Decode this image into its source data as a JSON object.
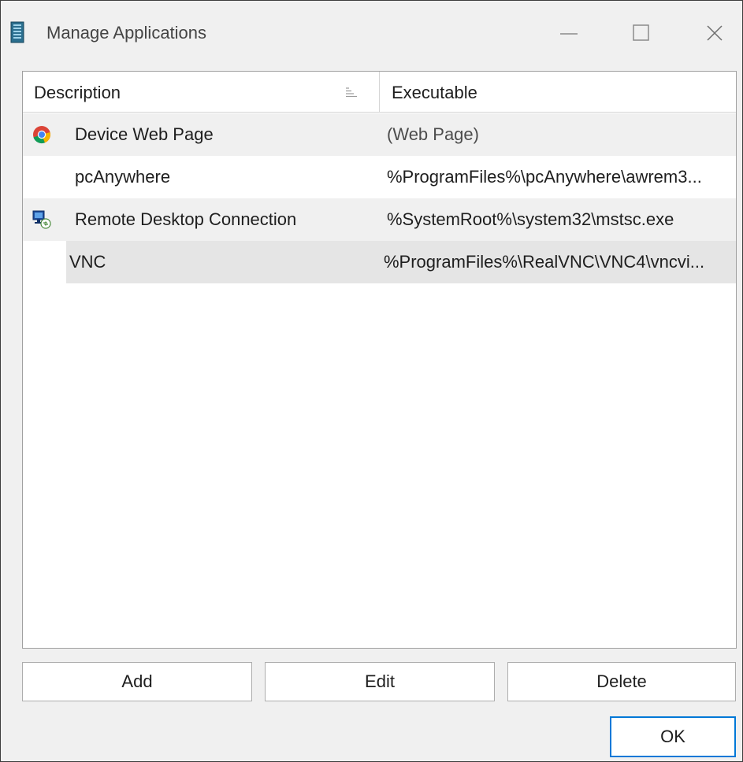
{
  "window": {
    "title": "Manage Applications",
    "icons": {
      "app": "server-tower-icon",
      "minimize": "minimize-icon",
      "maximize": "maximize-icon",
      "close": "close-icon"
    }
  },
  "list": {
    "columns": [
      {
        "label": "Description",
        "sort": "ascending",
        "sort_icon": "sort-ascending-icon"
      },
      {
        "label": "Executable"
      }
    ],
    "rows": [
      {
        "description": "Device Web Page",
        "executable": "(Web Page)",
        "icon": "chrome-browser-icon"
      },
      {
        "description": "pcAnywhere",
        "executable": "%ProgramFiles%\\pcAnywhere\\awrem3...",
        "icon": ""
      },
      {
        "description": "Remote Desktop Connection",
        "executable": "%SystemRoot%\\system32\\mstsc.exe",
        "icon": "remote-desktop-icon"
      },
      {
        "description": "VNC",
        "executable": "%ProgramFiles%\\RealVNC\\VNC4\\vncvi...",
        "icon": "",
        "selected": true
      }
    ]
  },
  "buttons": {
    "add": "Add",
    "edit": "Edit",
    "delete": "Delete",
    "ok": "OK"
  },
  "colors": {
    "accent": "#0078d7",
    "row_alt": "#f0f0f0",
    "row_selected": "#e5e5e5",
    "window_bg": "#f0f0f0"
  }
}
